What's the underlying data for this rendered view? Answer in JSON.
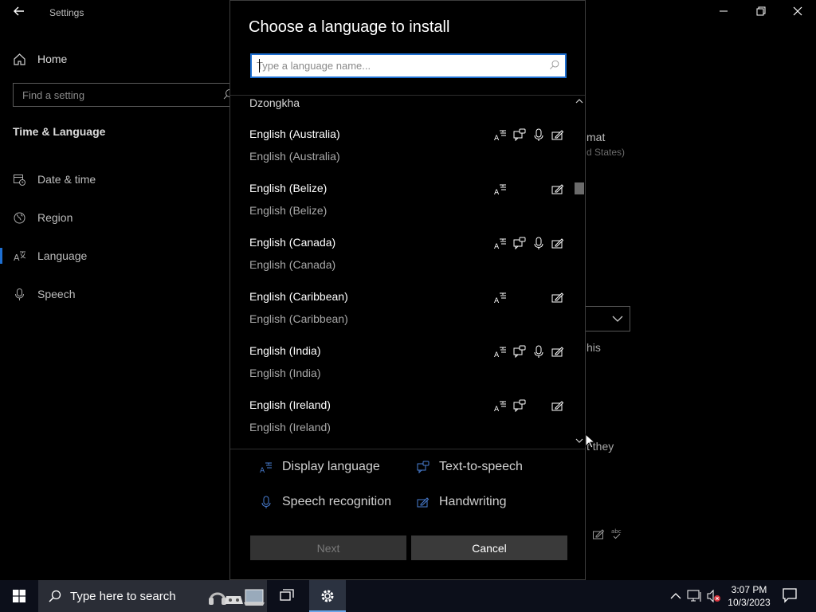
{
  "settings_window": {
    "title": "Settings",
    "home_label": "Home",
    "search_placeholder": "Find a setting",
    "section_title": "Time & Language",
    "nav_items": [
      {
        "label": "Date & time",
        "icon": "calendar-clock-icon"
      },
      {
        "label": "Region",
        "icon": "globe-icon"
      },
      {
        "label": "Language",
        "icon": "language-icon",
        "selected": true
      },
      {
        "label": "Speech",
        "icon": "microphone-icon"
      }
    ],
    "partial_texts": {
      "format_fragment": "mat",
      "region_fragment": "d States)",
      "this_fragment": "his",
      "they_fragment": "t they"
    }
  },
  "dialog": {
    "title": "Choose a language to install",
    "search_placeholder": "Type a language name...",
    "languages": [
      {
        "native": "Dzongkha",
        "english": "",
        "features": []
      },
      {
        "native": "English (Australia)",
        "english": "English (Australia)",
        "features": [
          "display",
          "tts",
          "speech",
          "handwriting"
        ]
      },
      {
        "native": "English (Belize)",
        "english": "English (Belize)",
        "features": [
          "display",
          "handwriting"
        ]
      },
      {
        "native": "English (Canada)",
        "english": "English (Canada)",
        "features": [
          "display",
          "tts",
          "speech",
          "handwriting"
        ]
      },
      {
        "native": "English (Caribbean)",
        "english": "English (Caribbean)",
        "features": [
          "display",
          "handwriting"
        ]
      },
      {
        "native": "English (India)",
        "english": "English (India)",
        "features": [
          "display",
          "tts",
          "speech",
          "handwriting"
        ]
      },
      {
        "native": "English (Ireland)",
        "english": "English (Ireland)",
        "features": [
          "display",
          "tts",
          "handwriting"
        ]
      }
    ],
    "legend": {
      "display": "Display language",
      "tts": "Text-to-speech",
      "speech": "Speech recognition",
      "handwriting": "Handwriting"
    },
    "buttons": {
      "next": "Next",
      "cancel": "Cancel"
    }
  },
  "taskbar": {
    "search_label": "Type here to search",
    "time": "3:07 PM",
    "date": "10/3/2023"
  },
  "colors": {
    "accent": "#1e6fd1",
    "legend_icon": "#4a7fd4"
  }
}
